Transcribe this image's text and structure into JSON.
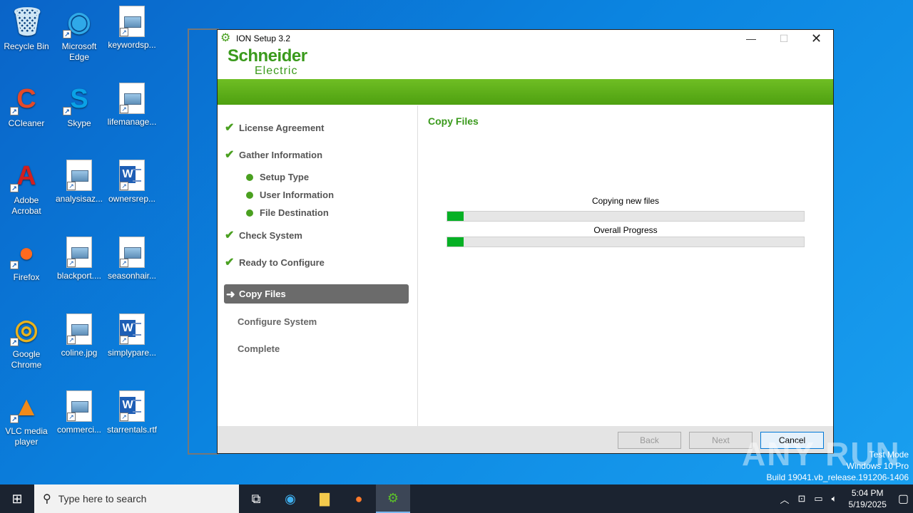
{
  "desktop": {
    "icons": [
      {
        "label": "Recycle Bin",
        "icon": "recycle-bin-icon"
      },
      {
        "label": "Microsoft Edge",
        "icon": "edge-icon"
      },
      {
        "label": "keywordsp...",
        "icon": "image-file-icon"
      },
      {
        "label": "CCleaner",
        "icon": "ccleaner-icon"
      },
      {
        "label": "Skype",
        "icon": "skype-icon"
      },
      {
        "label": "lifemanage...",
        "icon": "image-file-icon"
      },
      {
        "label": "Adobe Acrobat",
        "icon": "acrobat-icon"
      },
      {
        "label": "analysisaz...",
        "icon": "image-file-icon"
      },
      {
        "label": "ownersrep...",
        "icon": "word-doc-icon"
      },
      {
        "label": "Firefox",
        "icon": "firefox-icon"
      },
      {
        "label": "blackport....",
        "icon": "image-file-icon"
      },
      {
        "label": "seasonhair...",
        "icon": "image-file-icon"
      },
      {
        "label": "Google Chrome",
        "icon": "chrome-icon"
      },
      {
        "label": "coline.jpg",
        "icon": "image-file-icon"
      },
      {
        "label": "simplypare...",
        "icon": "word-doc-icon"
      },
      {
        "label": "VLC media player",
        "icon": "vlc-icon"
      },
      {
        "label": "commerci...",
        "icon": "image-file-icon"
      },
      {
        "label": "starrentals.rtf",
        "icon": "word-doc-icon"
      }
    ]
  },
  "window": {
    "title": "ION Setup 3.2",
    "logo_line1": "Schneider",
    "logo_line2": "Electric",
    "minimize": "—",
    "maximize": "☐",
    "close": "✕"
  },
  "steps": {
    "license": "License Agreement",
    "gather": "Gather Information",
    "setup_type": "Setup Type",
    "user_info": "User Information",
    "file_dest": "File Destination",
    "check_system": "Check System",
    "ready": "Ready to Configure",
    "copy_files": "Copy Files",
    "configure": "Configure System",
    "complete": "Complete"
  },
  "main": {
    "title": "Copy Files",
    "progress1_label": "Copying new files",
    "progress1_percent": 4.5,
    "progress2_label": "Overall Progress",
    "progress2_percent": 4.5
  },
  "buttons": {
    "back": "Back",
    "next": "Next",
    "cancel": "Cancel"
  },
  "watermark": {
    "brand": "ANY RUN",
    "line1": "Test Mode",
    "line2": "Windows 10 Pro",
    "line3": "Build 19041.vb_release.191206-1406"
  },
  "taskbar": {
    "search_placeholder": "Type here to search",
    "time": "5:04 PM",
    "date": "5/19/2025"
  }
}
